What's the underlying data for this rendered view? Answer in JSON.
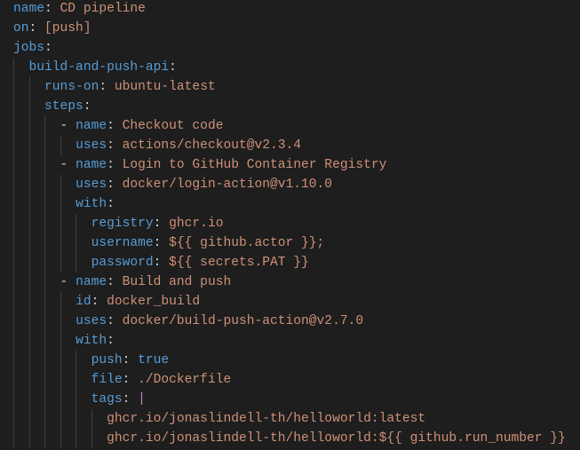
{
  "editor": {
    "language": "yaml",
    "colors": {
      "background": "#1e1e1e",
      "key": "#569cd6",
      "string": "#ce9178",
      "keyword": "#569cd6",
      "pipe": "#c586c0",
      "punct": "#d4d4d4",
      "guide": "#404040"
    },
    "lines": [
      {
        "indent": "",
        "tokens": [
          {
            "k": "key",
            "t": "name"
          },
          {
            "k": "punct",
            "t": ": "
          },
          {
            "k": "string",
            "t": "CD pipeline"
          }
        ]
      },
      {
        "indent": "",
        "tokens": [
          {
            "k": "key",
            "t": "on"
          },
          {
            "k": "punct",
            "t": ": "
          },
          {
            "k": "string",
            "t": "[push]"
          }
        ]
      },
      {
        "indent": "",
        "tokens": [
          {
            "k": "key",
            "t": "jobs"
          },
          {
            "k": "punct",
            "t": ":"
          }
        ]
      },
      {
        "indent": "  ",
        "tokens": [
          {
            "k": "key",
            "t": "build-and-push-api"
          },
          {
            "k": "punct",
            "t": ":"
          }
        ]
      },
      {
        "indent": "    ",
        "tokens": [
          {
            "k": "key",
            "t": "runs-on"
          },
          {
            "k": "punct",
            "t": ": "
          },
          {
            "k": "string",
            "t": "ubuntu-latest"
          }
        ]
      },
      {
        "indent": "    ",
        "tokens": [
          {
            "k": "key",
            "t": "steps"
          },
          {
            "k": "punct",
            "t": ":"
          }
        ]
      },
      {
        "indent": "      ",
        "tokens": [
          {
            "k": "punct",
            "t": "- "
          },
          {
            "k": "key",
            "t": "name"
          },
          {
            "k": "punct",
            "t": ": "
          },
          {
            "k": "string",
            "t": "Checkout code"
          }
        ]
      },
      {
        "indent": "        ",
        "tokens": [
          {
            "k": "key",
            "t": "uses"
          },
          {
            "k": "punct",
            "t": ": "
          },
          {
            "k": "string",
            "t": "actions/checkout@v2.3.4"
          }
        ]
      },
      {
        "indent": "      ",
        "tokens": [
          {
            "k": "punct",
            "t": "- "
          },
          {
            "k": "key",
            "t": "name"
          },
          {
            "k": "punct",
            "t": ": "
          },
          {
            "k": "string",
            "t": "Login to GitHub Container Registry"
          }
        ]
      },
      {
        "indent": "        ",
        "tokens": [
          {
            "k": "key",
            "t": "uses"
          },
          {
            "k": "punct",
            "t": ": "
          },
          {
            "k": "string",
            "t": "docker/login-action@v1.10.0"
          }
        ]
      },
      {
        "indent": "        ",
        "tokens": [
          {
            "k": "key",
            "t": "with"
          },
          {
            "k": "punct",
            "t": ":"
          }
        ]
      },
      {
        "indent": "          ",
        "tokens": [
          {
            "k": "key",
            "t": "registry"
          },
          {
            "k": "punct",
            "t": ": "
          },
          {
            "k": "string",
            "t": "ghcr.io"
          }
        ]
      },
      {
        "indent": "          ",
        "tokens": [
          {
            "k": "key",
            "t": "username"
          },
          {
            "k": "punct",
            "t": ": "
          },
          {
            "k": "string",
            "t": "${{ github.actor }};"
          }
        ]
      },
      {
        "indent": "          ",
        "tokens": [
          {
            "k": "key",
            "t": "password"
          },
          {
            "k": "punct",
            "t": ": "
          },
          {
            "k": "string",
            "t": "${{ secrets.PAT }}"
          }
        ]
      },
      {
        "indent": "      ",
        "tokens": [
          {
            "k": "punct",
            "t": "- "
          },
          {
            "k": "key",
            "t": "name"
          },
          {
            "k": "punct",
            "t": ": "
          },
          {
            "k": "string",
            "t": "Build and push"
          }
        ]
      },
      {
        "indent": "        ",
        "tokens": [
          {
            "k": "key",
            "t": "id"
          },
          {
            "k": "punct",
            "t": ": "
          },
          {
            "k": "string",
            "t": "docker_build"
          }
        ]
      },
      {
        "indent": "        ",
        "tokens": [
          {
            "k": "key",
            "t": "uses"
          },
          {
            "k": "punct",
            "t": ": "
          },
          {
            "k": "string",
            "t": "docker/build-push-action@v2.7.0"
          }
        ]
      },
      {
        "indent": "        ",
        "tokens": [
          {
            "k": "key",
            "t": "with"
          },
          {
            "k": "punct",
            "t": ":"
          }
        ]
      },
      {
        "indent": "          ",
        "tokens": [
          {
            "k": "key",
            "t": "push"
          },
          {
            "k": "punct",
            "t": ": "
          },
          {
            "k": "keyword",
            "t": "true"
          }
        ]
      },
      {
        "indent": "          ",
        "tokens": [
          {
            "k": "key",
            "t": "file"
          },
          {
            "k": "punct",
            "t": ": "
          },
          {
            "k": "string",
            "t": "./Dockerfile"
          }
        ]
      },
      {
        "indent": "          ",
        "tokens": [
          {
            "k": "key",
            "t": "tags"
          },
          {
            "k": "punct",
            "t": ": "
          },
          {
            "k": "pipe",
            "t": "|"
          }
        ]
      },
      {
        "indent": "            ",
        "tokens": [
          {
            "k": "string",
            "t": "ghcr.io/jonaslindell-th/helloworld:latest"
          }
        ]
      },
      {
        "indent": "            ",
        "tokens": [
          {
            "k": "string",
            "t": "ghcr.io/jonaslindell-th/helloworld:${{ github.run_number }}"
          }
        ]
      }
    ]
  }
}
